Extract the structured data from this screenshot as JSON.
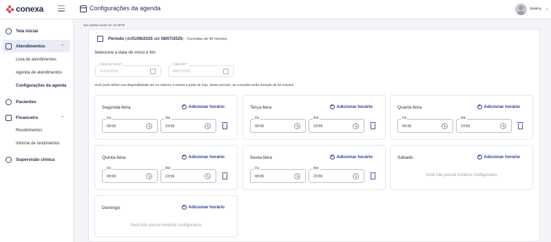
{
  "app": {
    "logo": "conexa",
    "page_title": "Configurações da agenda"
  },
  "user": {
    "name": "Jessica"
  },
  "session_notice": "Sua sessão expira em: 01:00:00",
  "sidebar": {
    "home": "Tela inicial",
    "atendimentos": "Atendimentos",
    "sub_atendimentos": [
      "Lista de atendimentos",
      "Agenda de atendimentos",
      "Configurações da agenda"
    ],
    "pacientes": "Pacientes",
    "financeiro": "Financeiro",
    "sub_financeiro": [
      "Recebimentos",
      "Informe de rendimentos"
    ],
    "supervisao": "Supervisão clínica"
  },
  "period": {
    "label": "Período",
    "de": "(de",
    "start": "01/06/2025",
    "ate": "até",
    "end": "08/07/2025",
    "suffix": ") - Consultas de 40 minutos"
  },
  "date_select": {
    "prompt": "Selecione a data de início e fim",
    "start_label": "Data de início*",
    "start_value": "01/06/2025",
    "end_label": "Data fim*",
    "end_value": "08/07/2025"
  },
  "info": "Você pode definir sua disponibilidade até no máximo 3 meses a partir de hoje. Neste período, as consultas terão duração de 40 minutos.",
  "add_label": "Adicionar horário",
  "from_label": "De",
  "to_label": "Até",
  "empty_label": "Você não possui horários configurados",
  "days": [
    {
      "name": "Segunda-feira",
      "from": "00:00",
      "to": "23:59"
    },
    {
      "name": "Terça-feira",
      "from": "00:00",
      "to": "23:59"
    },
    {
      "name": "Quarta-feira",
      "from": "00:00",
      "to": "23:59"
    },
    {
      "name": "Quinta-feira",
      "from": "00:00",
      "to": "23:59"
    },
    {
      "name": "Sexta-feira",
      "from": "00:00",
      "to": "23:59"
    },
    {
      "name": "Sábado"
    },
    {
      "name": "Domingo"
    }
  ]
}
